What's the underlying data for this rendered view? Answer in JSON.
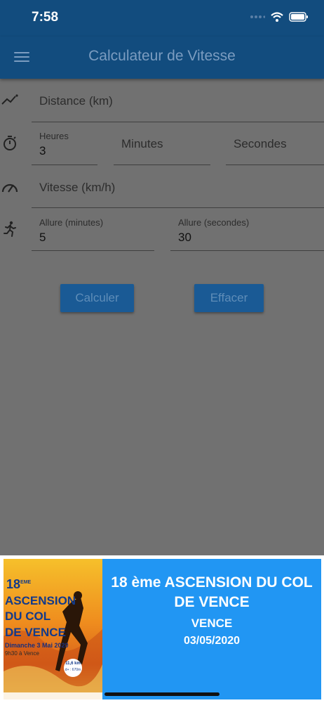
{
  "status": {
    "time": "7:58"
  },
  "app": {
    "title": "Calculateur de Vitesse"
  },
  "icons": {
    "menu": "menu-icon",
    "distance": "trending-icon",
    "time": "stopwatch-icon",
    "speed": "speedometer-icon",
    "pace": "runner-icon"
  },
  "form": {
    "distance": {
      "placeholder": "Distance (km)"
    },
    "hours": {
      "label": "Heures",
      "value": "3"
    },
    "minutes": {
      "placeholder": "Minutes"
    },
    "seconds": {
      "placeholder": "Secondes"
    },
    "speed": {
      "placeholder": "Vitesse (km/h)"
    },
    "pace_minutes": {
      "label": "Allure (minutes)",
      "value": "5"
    },
    "pace_seconds": {
      "label": "Allure (secondes)",
      "value": "30"
    }
  },
  "buttons": {
    "calculate": "Calculer",
    "clear": "Effacer"
  },
  "ad": {
    "title": "18 ème ASCENSION DU COL DE VENCE",
    "city": "VENCE",
    "date": "03/05/2020",
    "poster": {
      "edition": "18",
      "edition_suffix": "EME",
      "line1": "ASCENSION",
      "line2": "DU COL",
      "line3": "DE VENCE",
      "date_line": "Dimanche 3 Mai 2020",
      "time_line": "9h30 à Vence",
      "distance": "11,6 km",
      "elevation": "d+ : 670m"
    }
  },
  "colors": {
    "appbar": "#124c7e",
    "scrim": "#717171",
    "button": "#1a5a95",
    "ad_panel": "#2196f3"
  }
}
